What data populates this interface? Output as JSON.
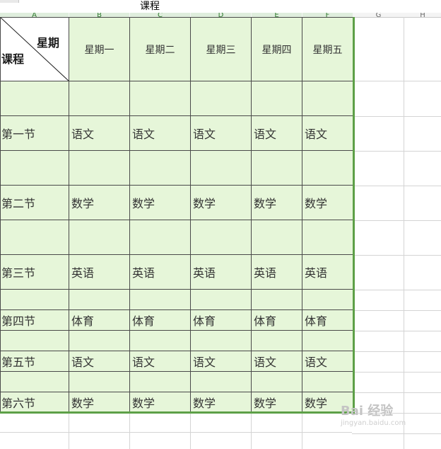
{
  "formula_bar": {
    "value": "课程"
  },
  "column_headers": [
    "A",
    "B",
    "C",
    "D",
    "E",
    "F",
    "G",
    "H"
  ],
  "corner": {
    "top_label": "星期",
    "bottom_label": "课程"
  },
  "days": [
    "星期一",
    "星期二",
    "星期三",
    "星期四",
    "星期五"
  ],
  "lessons": [
    {
      "label": "第一节",
      "subjects": [
        "语文",
        "语文",
        "语文",
        "语文",
        "语文"
      ]
    },
    {
      "label": "第二节",
      "subjects": [
        "数学",
        "数学",
        "数学",
        "数学",
        "数学"
      ]
    },
    {
      "label": "第三节",
      "subjects": [
        "英语",
        "英语",
        "英语",
        "英语",
        "英语"
      ]
    },
    {
      "label": "第四节",
      "subjects": [
        "体育",
        "体育",
        "体育",
        "体育",
        "体育"
      ]
    },
    {
      "label": "第五节",
      "subjects": [
        "语文",
        "语文",
        "语文",
        "语文",
        "语文"
      ]
    },
    {
      "label": "第六节",
      "subjects": [
        "数学",
        "数学",
        "数学",
        "数学",
        "数学"
      ]
    }
  ],
  "colors": {
    "table_fill": "#e6f6d9",
    "table_border_accent": "#5da047"
  },
  "watermark": {
    "text": "Bai 经验",
    "sub": "jingyan.baidu.com"
  }
}
